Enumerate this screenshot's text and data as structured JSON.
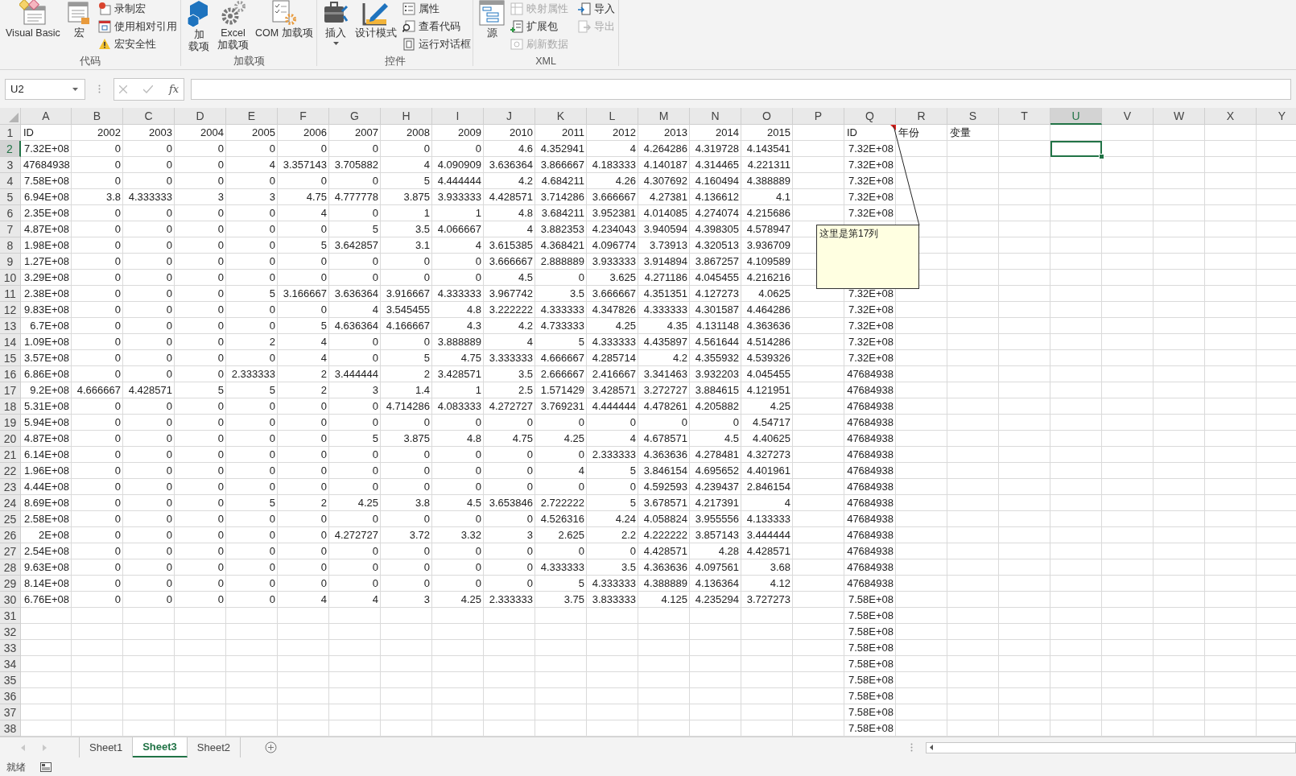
{
  "ribbon": {
    "groups": [
      {
        "label": "代码",
        "large": [
          {
            "lines": [
              "Visual Basic"
            ],
            "dropdown": false
          },
          {
            "lines": [
              "宏"
            ],
            "dropdown": false
          }
        ],
        "small": [
          {
            "label": "录制宏",
            "disabled": false
          },
          {
            "label": "使用相对引用",
            "disabled": false
          },
          {
            "label": "宏安全性",
            "disabled": false
          }
        ]
      },
      {
        "label": "加载项",
        "large": [
          {
            "lines": [
              "加",
              "载项"
            ],
            "dropdown": false
          },
          {
            "lines": [
              "Excel",
              "加载项"
            ],
            "dropdown": false
          },
          {
            "lines": [
              "COM 加载项"
            ],
            "dropdown": false
          }
        ]
      },
      {
        "label": "控件",
        "large": [
          {
            "lines": [
              "插入"
            ],
            "dropdown": true
          },
          {
            "lines": [
              "设计模式"
            ],
            "dropdown": false
          }
        ],
        "small": [
          {
            "label": "属性",
            "disabled": false
          },
          {
            "label": "查看代码",
            "disabled": false
          },
          {
            "label": "运行对话框",
            "disabled": false
          }
        ]
      },
      {
        "label": "XML",
        "large": [
          {
            "lines": [
              "源"
            ],
            "dropdown": false
          }
        ],
        "small": [
          {
            "label": "映射属性",
            "disabled": true
          },
          {
            "label": "扩展包",
            "disabled": false
          },
          {
            "label": "刷新数据",
            "disabled": true
          },
          {
            "label": "导入",
            "disabled": false
          },
          {
            "label": "导出",
            "disabled": true
          }
        ]
      }
    ]
  },
  "formula_bar": {
    "name_box": "U2",
    "fx": "fx"
  },
  "columns": [
    {
      "label": "A",
      "selected": false
    },
    {
      "label": "B",
      "selected": false
    },
    {
      "label": "C",
      "selected": false
    },
    {
      "label": "D",
      "selected": false
    },
    {
      "label": "E",
      "selected": false
    },
    {
      "label": "F",
      "selected": false
    },
    {
      "label": "G",
      "selected": false
    },
    {
      "label": "H",
      "selected": false
    },
    {
      "label": "I",
      "selected": false
    },
    {
      "label": "J",
      "selected": false
    },
    {
      "label": "K",
      "selected": false
    },
    {
      "label": "L",
      "selected": false
    },
    {
      "label": "M",
      "selected": false
    },
    {
      "label": "N",
      "selected": false
    },
    {
      "label": "O",
      "selected": false
    },
    {
      "label": "P",
      "selected": false
    },
    {
      "label": "Q",
      "selected": false
    },
    {
      "label": "R",
      "selected": false
    },
    {
      "label": "S",
      "selected": false
    },
    {
      "label": "T",
      "selected": false
    },
    {
      "label": "U",
      "selected": true
    },
    {
      "label": "V",
      "selected": false
    },
    {
      "label": "W",
      "selected": false
    },
    {
      "label": "X",
      "selected": false
    },
    {
      "label": "Y",
      "selected": false
    }
  ],
  "rows": [
    {
      "label": "1",
      "selected": false,
      "kind": "labels",
      "cells": [
        "ID",
        "2002",
        "2003",
        "2004",
        "2005",
        "2006",
        "2007",
        "2008",
        "2009",
        "2010",
        "2011",
        "2012",
        "2013",
        "2014",
        "2015"
      ],
      "q": "ID",
      "r": "年份",
      "s": "变量"
    },
    {
      "label": "2",
      "selected": true,
      "kind": "data",
      "cells": [
        "7.32E+08",
        "0",
        "0",
        "0",
        "0",
        "0",
        "0",
        "0",
        "0",
        "4.6",
        "4.352941",
        "4",
        "4.264286",
        "4.319728",
        "4.143541"
      ],
      "q": "7.32E+08"
    },
    {
      "label": "3",
      "selected": false,
      "kind": "data",
      "cells": [
        "47684938",
        "0",
        "0",
        "0",
        "4",
        "3.357143",
        "3.705882",
        "4",
        "4.090909",
        "3.636364",
        "3.866667",
        "4.183333",
        "4.140187",
        "4.314465",
        "4.221311"
      ],
      "q": "7.32E+08"
    },
    {
      "label": "4",
      "selected": false,
      "kind": "data",
      "cells": [
        "7.58E+08",
        "0",
        "0",
        "0",
        "0",
        "0",
        "0",
        "5",
        "4.444444",
        "4.2",
        "4.684211",
        "4.26",
        "4.307692",
        "4.160494",
        "4.388889"
      ],
      "q": "7.32E+08"
    },
    {
      "label": "5",
      "selected": false,
      "kind": "data",
      "cells": [
        "6.94E+08",
        "3.8",
        "4.333333",
        "3",
        "3",
        "4.75",
        "4.777778",
        "3.875",
        "3.933333",
        "4.428571",
        "3.714286",
        "3.666667",
        "4.27381",
        "4.136612",
        "4.1"
      ],
      "q": "7.32E+08"
    },
    {
      "label": "6",
      "selected": false,
      "kind": "data",
      "cells": [
        "2.35E+08",
        "0",
        "0",
        "0",
        "0",
        "4",
        "0",
        "1",
        "1",
        "4.8",
        "3.684211",
        "3.952381",
        "4.014085",
        "4.274074",
        "4.215686"
      ],
      "q": "7.32E+08"
    },
    {
      "label": "7",
      "selected": false,
      "kind": "data",
      "cells": [
        "4.87E+08",
        "0",
        "0",
        "0",
        "0",
        "0",
        "5",
        "3.5",
        "4.066667",
        "4",
        "3.882353",
        "4.234043",
        "3.940594",
        "4.398305",
        "4.578947"
      ]
    },
    {
      "label": "8",
      "selected": false,
      "kind": "data",
      "cells": [
        "1.98E+08",
        "0",
        "0",
        "0",
        "0",
        "5",
        "3.642857",
        "3.1",
        "4",
        "3.615385",
        "4.368421",
        "4.096774",
        "3.73913",
        "4.320513",
        "3.936709"
      ]
    },
    {
      "label": "9",
      "selected": false,
      "kind": "data",
      "cells": [
        "1.27E+08",
        "0",
        "0",
        "0",
        "0",
        "0",
        "0",
        "0",
        "0",
        "3.666667",
        "2.888889",
        "3.933333",
        "3.914894",
        "3.867257",
        "4.109589"
      ]
    },
    {
      "label": "10",
      "selected": false,
      "kind": "data",
      "cells": [
        "3.29E+08",
        "0",
        "0",
        "0",
        "0",
        "0",
        "0",
        "0",
        "0",
        "4.5",
        "0",
        "3.625",
        "4.271186",
        "4.045455",
        "4.216216"
      ]
    },
    {
      "label": "11",
      "selected": false,
      "kind": "data",
      "cells": [
        "2.38E+08",
        "0",
        "0",
        "0",
        "5",
        "3.166667",
        "3.636364",
        "3.916667",
        "4.333333",
        "3.967742",
        "3.5",
        "3.666667",
        "4.351351",
        "4.127273",
        "4.0625"
      ],
      "q": "7.32E+08"
    },
    {
      "label": "12",
      "selected": false,
      "kind": "data",
      "cells": [
        "9.83E+08",
        "0",
        "0",
        "0",
        "0",
        "0",
        "4",
        "3.545455",
        "4.8",
        "3.222222",
        "4.333333",
        "4.347826",
        "4.333333",
        "4.301587",
        "4.464286"
      ],
      "q": "7.32E+08"
    },
    {
      "label": "13",
      "selected": false,
      "kind": "data",
      "cells": [
        "6.7E+08",
        "0",
        "0",
        "0",
        "0",
        "5",
        "4.636364",
        "4.166667",
        "4.3",
        "4.2",
        "4.733333",
        "4.25",
        "4.35",
        "4.131148",
        "4.363636"
      ],
      "q": "7.32E+08"
    },
    {
      "label": "14",
      "selected": false,
      "kind": "data",
      "cells": [
        "1.09E+08",
        "0",
        "0",
        "0",
        "2",
        "4",
        "0",
        "0",
        "3.888889",
        "4",
        "5",
        "4.333333",
        "4.435897",
        "4.561644",
        "4.514286"
      ],
      "q": "7.32E+08"
    },
    {
      "label": "15",
      "selected": false,
      "kind": "data",
      "cells": [
        "3.57E+08",
        "0",
        "0",
        "0",
        "0",
        "4",
        "0",
        "5",
        "4.75",
        "3.333333",
        "4.666667",
        "4.285714",
        "4.2",
        "4.355932",
        "4.539326"
      ],
      "q": "7.32E+08"
    },
    {
      "label": "16",
      "selected": false,
      "kind": "data",
      "cells": [
        "6.86E+08",
        "0",
        "0",
        "0",
        "2.333333",
        "2",
        "3.444444",
        "2",
        "3.428571",
        "3.5",
        "2.666667",
        "2.416667",
        "3.341463",
        "3.932203",
        "4.045455"
      ],
      "q": "47684938"
    },
    {
      "label": "17",
      "selected": false,
      "kind": "data",
      "cells": [
        "9.2E+08",
        "4.666667",
        "4.428571",
        "5",
        "5",
        "2",
        "3",
        "1.4",
        "1",
        "2.5",
        "1.571429",
        "3.428571",
        "3.272727",
        "3.884615",
        "4.121951"
      ],
      "q": "47684938"
    },
    {
      "label": "18",
      "selected": false,
      "kind": "data",
      "cells": [
        "5.31E+08",
        "0",
        "0",
        "0",
        "0",
        "0",
        "0",
        "4.714286",
        "4.083333",
        "4.272727",
        "3.769231",
        "4.444444",
        "4.478261",
        "4.205882",
        "4.25"
      ],
      "q": "47684938"
    },
    {
      "label": "19",
      "selected": false,
      "kind": "data",
      "cells": [
        "5.94E+08",
        "0",
        "0",
        "0",
        "0",
        "0",
        "0",
        "0",
        "0",
        "0",
        "0",
        "0",
        "0",
        "0",
        "4.54717"
      ],
      "q": "47684938"
    },
    {
      "label": "20",
      "selected": false,
      "kind": "data",
      "cells": [
        "4.87E+08",
        "0",
        "0",
        "0",
        "0",
        "0",
        "5",
        "3.875",
        "4.8",
        "4.75",
        "4.25",
        "4",
        "4.678571",
        "4.5",
        "4.40625"
      ],
      "q": "47684938"
    },
    {
      "label": "21",
      "selected": false,
      "kind": "data",
      "cells": [
        "6.14E+08",
        "0",
        "0",
        "0",
        "0",
        "0",
        "0",
        "0",
        "0",
        "0",
        "0",
        "2.333333",
        "4.363636",
        "4.278481",
        "4.327273"
      ],
      "q": "47684938"
    },
    {
      "label": "22",
      "selected": false,
      "kind": "data",
      "cells": [
        "1.96E+08",
        "0",
        "0",
        "0",
        "0",
        "0",
        "0",
        "0",
        "0",
        "0",
        "4",
        "5",
        "3.846154",
        "4.695652",
        "4.401961"
      ],
      "q": "47684938"
    },
    {
      "label": "23",
      "selected": false,
      "kind": "data",
      "cells": [
        "4.44E+08",
        "0",
        "0",
        "0",
        "0",
        "0",
        "0",
        "0",
        "0",
        "0",
        "0",
        "0",
        "4.592593",
        "4.239437",
        "2.846154"
      ],
      "q": "47684938"
    },
    {
      "label": "24",
      "selected": false,
      "kind": "data",
      "cells": [
        "8.69E+08",
        "0",
        "0",
        "0",
        "5",
        "2",
        "4.25",
        "3.8",
        "4.5",
        "3.653846",
        "2.722222",
        "5",
        "3.678571",
        "4.217391",
        "4"
      ],
      "q": "47684938"
    },
    {
      "label": "25",
      "selected": false,
      "kind": "data",
      "cells": [
        "2.58E+08",
        "0",
        "0",
        "0",
        "0",
        "0",
        "0",
        "0",
        "0",
        "0",
        "4.526316",
        "4.24",
        "4.058824",
        "3.955556",
        "4.133333"
      ],
      "q": "47684938"
    },
    {
      "label": "26",
      "selected": false,
      "kind": "data",
      "cells": [
        "2E+08",
        "0",
        "0",
        "0",
        "0",
        "0",
        "4.272727",
        "3.72",
        "3.32",
        "3",
        "2.625",
        "2.2",
        "4.222222",
        "3.857143",
        "3.444444"
      ],
      "q": "47684938"
    },
    {
      "label": "27",
      "selected": false,
      "kind": "data",
      "cells": [
        "2.54E+08",
        "0",
        "0",
        "0",
        "0",
        "0",
        "0",
        "0",
        "0",
        "0",
        "0",
        "0",
        "4.428571",
        "4.28",
        "4.428571"
      ],
      "q": "47684938"
    },
    {
      "label": "28",
      "selected": false,
      "kind": "data",
      "cells": [
        "9.63E+08",
        "0",
        "0",
        "0",
        "0",
        "0",
        "0",
        "0",
        "0",
        "0",
        "4.333333",
        "3.5",
        "4.363636",
        "4.097561",
        "3.68"
      ],
      "q": "47684938"
    },
    {
      "label": "29",
      "selected": false,
      "kind": "data",
      "cells": [
        "8.14E+08",
        "0",
        "0",
        "0",
        "0",
        "0",
        "0",
        "0",
        "0",
        "0",
        "5",
        "4.333333",
        "4.388889",
        "4.136364",
        "4.12"
      ],
      "q": "47684938"
    },
    {
      "label": "30",
      "selected": false,
      "kind": "data",
      "cells": [
        "6.76E+08",
        "0",
        "0",
        "0",
        "0",
        "4",
        "4",
        "3",
        "4.25",
        "2.333333",
        "3.75",
        "3.833333",
        "4.125",
        "4.235294",
        "3.727273"
      ],
      "q": "7.58E+08"
    },
    {
      "label": "31",
      "selected": false,
      "kind": "data",
      "q": "7.58E+08"
    },
    {
      "label": "32",
      "selected": false,
      "kind": "data",
      "q": "7.58E+08"
    },
    {
      "label": "33",
      "selected": false,
      "kind": "data",
      "q": "7.58E+08"
    },
    {
      "label": "34",
      "selected": false,
      "kind": "data",
      "q": "7.58E+08"
    },
    {
      "label": "35",
      "selected": false,
      "kind": "data",
      "q": "7.58E+08"
    },
    {
      "label": "36",
      "selected": false,
      "kind": "data",
      "q": "7.58E+08"
    },
    {
      "label": "37",
      "selected": false,
      "kind": "data",
      "q": "7.58E+08"
    },
    {
      "label": "38",
      "selected": false,
      "kind": "data",
      "q": "7.58E+08"
    }
  ],
  "comment": {
    "text": "这里是第17列"
  },
  "sheet_tabs": [
    {
      "label": "Sheet1",
      "selected": false
    },
    {
      "label": "Sheet3",
      "selected": true
    },
    {
      "label": "Sheet2",
      "selected": false
    }
  ],
  "status_bar": {
    "text": "就绪"
  }
}
